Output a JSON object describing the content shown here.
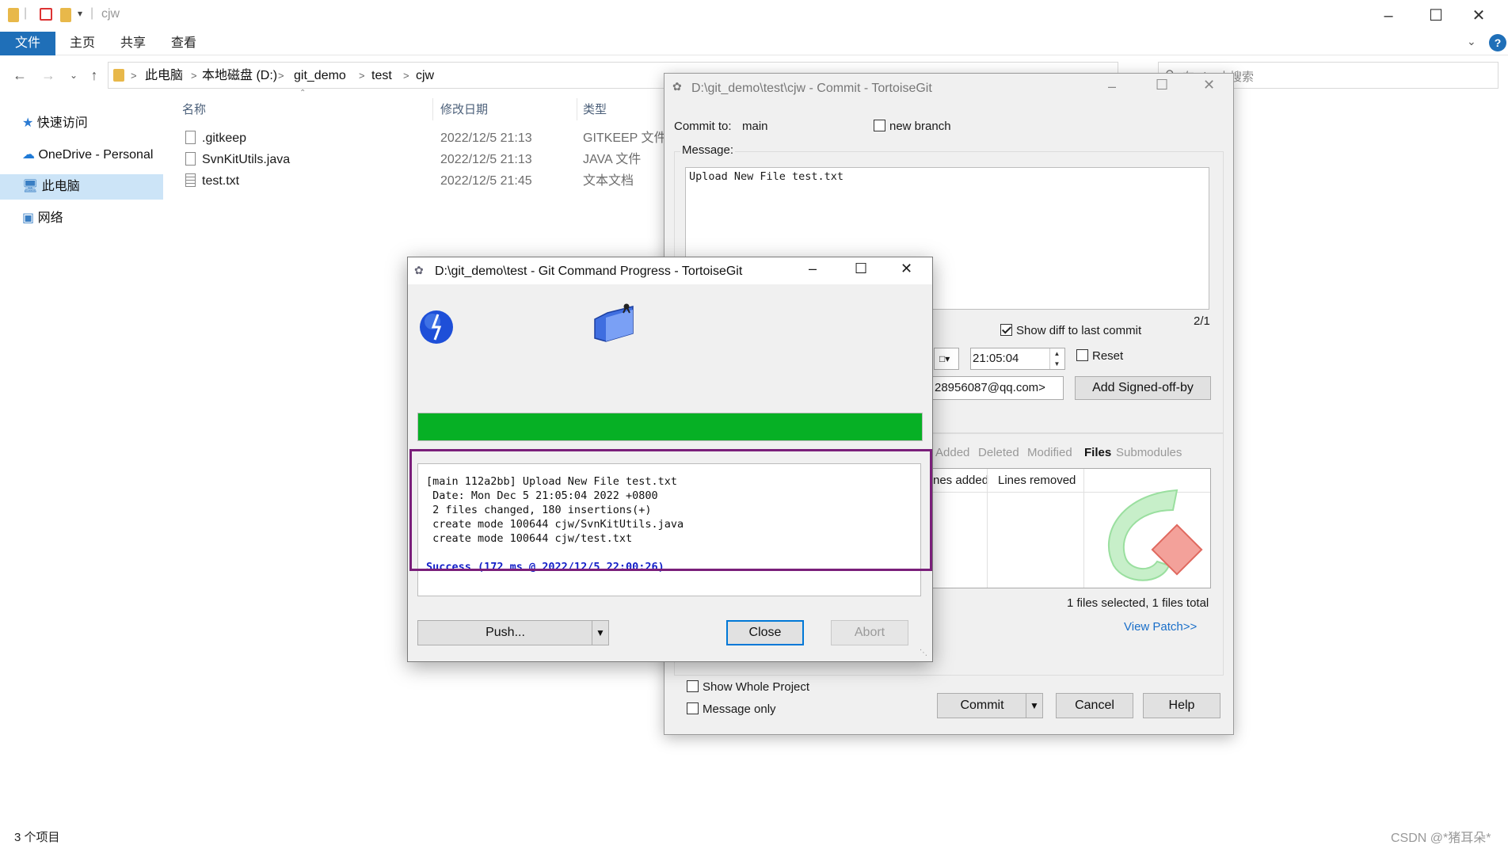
{
  "explorer": {
    "title": "cjw",
    "ribbon_tabs": [
      "文件",
      "主页",
      "共享",
      "查看"
    ],
    "breadcrumb": [
      "此电脑",
      "本地磁盘 (D:)",
      "git_demo",
      "test",
      "cjw"
    ],
    "search_placeholder": "在 cjw 中搜索",
    "sidebar": [
      {
        "label": "快速访问",
        "icon": "star-icon"
      },
      {
        "label": "OneDrive - Personal",
        "icon": "cloud-icon"
      },
      {
        "label": "此电脑",
        "icon": "computer-icon"
      },
      {
        "label": "网络",
        "icon": "network-icon"
      }
    ],
    "columns": [
      "名称",
      "修改日期",
      "类型"
    ],
    "files": [
      {
        "name": ".gitkeep",
        "date": "2022/12/5 21:13",
        "type": "GITKEEP 文件"
      },
      {
        "name": "SvnKitUtils.java",
        "date": "2022/12/5 21:13",
        "type": "JAVA 文件"
      },
      {
        "name": "test.txt",
        "date": "2022/12/5 21:45",
        "type": "文本文档"
      }
    ],
    "status": "3 个项目"
  },
  "commit_dialog": {
    "title": "D:\\git_demo\\test\\cjw - Commit - TortoiseGit",
    "commit_to_label": "Commit to:",
    "branch": "main",
    "new_branch_label": "new branch",
    "message_label": "Message:",
    "message": "Upload New File test.txt",
    "counter": "2/1",
    "show_diff_label": "Show diff to last commit",
    "time": "21:05:04",
    "reset_label": "Reset",
    "author_tail": "28956087@qq.com>",
    "signed_off_label": "Add Signed-off-by",
    "filter_tabs": [
      "Added",
      "Deleted",
      "Modified",
      "Files",
      "Submodules"
    ],
    "file_cols": [
      "nes added",
      "Lines removed"
    ],
    "files_summary": "1 files selected, 1 files total",
    "view_patch": "View Patch>>",
    "show_whole_label": "Show Whole Project",
    "message_only_label": "Message only",
    "commit_btn": "Commit",
    "cancel_btn": "Cancel",
    "help_btn": "Help"
  },
  "progress_dialog": {
    "title": "D:\\git_demo\\test - Git Command Progress - TortoiseGit",
    "progress": 1.0,
    "log": [
      "[main 112a2bb] Upload New File test.txt",
      " Date: Mon Dec 5 21:05:04 2022 +0800",
      " 2 files changed, 180 insertions(+)",
      " create mode 100644 cjw/SvnKitUtils.java",
      " create mode 100644 cjw/test.txt"
    ],
    "success": "Success (172 ms @ 2022/12/5 22:00:26)",
    "push_btn": "Push...",
    "close_btn": "Close",
    "abort_btn": "Abort"
  },
  "watermark": "CSDN @*猪耳朵*"
}
